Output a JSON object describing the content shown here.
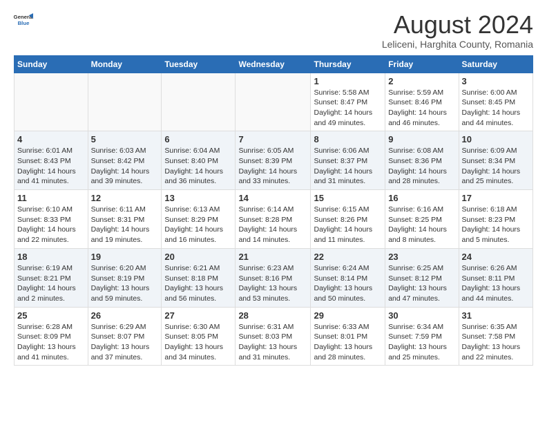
{
  "logo": {
    "general": "General",
    "blue": "Blue"
  },
  "title": "August 2024",
  "subtitle": "Leliceni, Harghita County, Romania",
  "weekdays": [
    "Sunday",
    "Monday",
    "Tuesday",
    "Wednesday",
    "Thursday",
    "Friday",
    "Saturday"
  ],
  "weeks": [
    [
      {
        "day": "",
        "content": ""
      },
      {
        "day": "",
        "content": ""
      },
      {
        "day": "",
        "content": ""
      },
      {
        "day": "",
        "content": ""
      },
      {
        "day": "1",
        "content": "Sunrise: 5:58 AM\nSunset: 8:47 PM\nDaylight: 14 hours and 49 minutes."
      },
      {
        "day": "2",
        "content": "Sunrise: 5:59 AM\nSunset: 8:46 PM\nDaylight: 14 hours and 46 minutes."
      },
      {
        "day": "3",
        "content": "Sunrise: 6:00 AM\nSunset: 8:45 PM\nDaylight: 14 hours and 44 minutes."
      }
    ],
    [
      {
        "day": "4",
        "content": "Sunrise: 6:01 AM\nSunset: 8:43 PM\nDaylight: 14 hours and 41 minutes."
      },
      {
        "day": "5",
        "content": "Sunrise: 6:03 AM\nSunset: 8:42 PM\nDaylight: 14 hours and 39 minutes."
      },
      {
        "day": "6",
        "content": "Sunrise: 6:04 AM\nSunset: 8:40 PM\nDaylight: 14 hours and 36 minutes."
      },
      {
        "day": "7",
        "content": "Sunrise: 6:05 AM\nSunset: 8:39 PM\nDaylight: 14 hours and 33 minutes."
      },
      {
        "day": "8",
        "content": "Sunrise: 6:06 AM\nSunset: 8:37 PM\nDaylight: 14 hours and 31 minutes."
      },
      {
        "day": "9",
        "content": "Sunrise: 6:08 AM\nSunset: 8:36 PM\nDaylight: 14 hours and 28 minutes."
      },
      {
        "day": "10",
        "content": "Sunrise: 6:09 AM\nSunset: 8:34 PM\nDaylight: 14 hours and 25 minutes."
      }
    ],
    [
      {
        "day": "11",
        "content": "Sunrise: 6:10 AM\nSunset: 8:33 PM\nDaylight: 14 hours and 22 minutes."
      },
      {
        "day": "12",
        "content": "Sunrise: 6:11 AM\nSunset: 8:31 PM\nDaylight: 14 hours and 19 minutes."
      },
      {
        "day": "13",
        "content": "Sunrise: 6:13 AM\nSunset: 8:29 PM\nDaylight: 14 hours and 16 minutes."
      },
      {
        "day": "14",
        "content": "Sunrise: 6:14 AM\nSunset: 8:28 PM\nDaylight: 14 hours and 14 minutes."
      },
      {
        "day": "15",
        "content": "Sunrise: 6:15 AM\nSunset: 8:26 PM\nDaylight: 14 hours and 11 minutes."
      },
      {
        "day": "16",
        "content": "Sunrise: 6:16 AM\nSunset: 8:25 PM\nDaylight: 14 hours and 8 minutes."
      },
      {
        "day": "17",
        "content": "Sunrise: 6:18 AM\nSunset: 8:23 PM\nDaylight: 14 hours and 5 minutes."
      }
    ],
    [
      {
        "day": "18",
        "content": "Sunrise: 6:19 AM\nSunset: 8:21 PM\nDaylight: 14 hours and 2 minutes."
      },
      {
        "day": "19",
        "content": "Sunrise: 6:20 AM\nSunset: 8:19 PM\nDaylight: 13 hours and 59 minutes."
      },
      {
        "day": "20",
        "content": "Sunrise: 6:21 AM\nSunset: 8:18 PM\nDaylight: 13 hours and 56 minutes."
      },
      {
        "day": "21",
        "content": "Sunrise: 6:23 AM\nSunset: 8:16 PM\nDaylight: 13 hours and 53 minutes."
      },
      {
        "day": "22",
        "content": "Sunrise: 6:24 AM\nSunset: 8:14 PM\nDaylight: 13 hours and 50 minutes."
      },
      {
        "day": "23",
        "content": "Sunrise: 6:25 AM\nSunset: 8:12 PM\nDaylight: 13 hours and 47 minutes."
      },
      {
        "day": "24",
        "content": "Sunrise: 6:26 AM\nSunset: 8:11 PM\nDaylight: 13 hours and 44 minutes."
      }
    ],
    [
      {
        "day": "25",
        "content": "Sunrise: 6:28 AM\nSunset: 8:09 PM\nDaylight: 13 hours and 41 minutes."
      },
      {
        "day": "26",
        "content": "Sunrise: 6:29 AM\nSunset: 8:07 PM\nDaylight: 13 hours and 37 minutes."
      },
      {
        "day": "27",
        "content": "Sunrise: 6:30 AM\nSunset: 8:05 PM\nDaylight: 13 hours and 34 minutes."
      },
      {
        "day": "28",
        "content": "Sunrise: 6:31 AM\nSunset: 8:03 PM\nDaylight: 13 hours and 31 minutes."
      },
      {
        "day": "29",
        "content": "Sunrise: 6:33 AM\nSunset: 8:01 PM\nDaylight: 13 hours and 28 minutes."
      },
      {
        "day": "30",
        "content": "Sunrise: 6:34 AM\nSunset: 7:59 PM\nDaylight: 13 hours and 25 minutes."
      },
      {
        "day": "31",
        "content": "Sunrise: 6:35 AM\nSunset: 7:58 PM\nDaylight: 13 hours and 22 minutes."
      }
    ]
  ],
  "colors": {
    "header_bg": "#2a6db5",
    "header_text": "#ffffff",
    "alt_row": "#e8f0f8"
  }
}
